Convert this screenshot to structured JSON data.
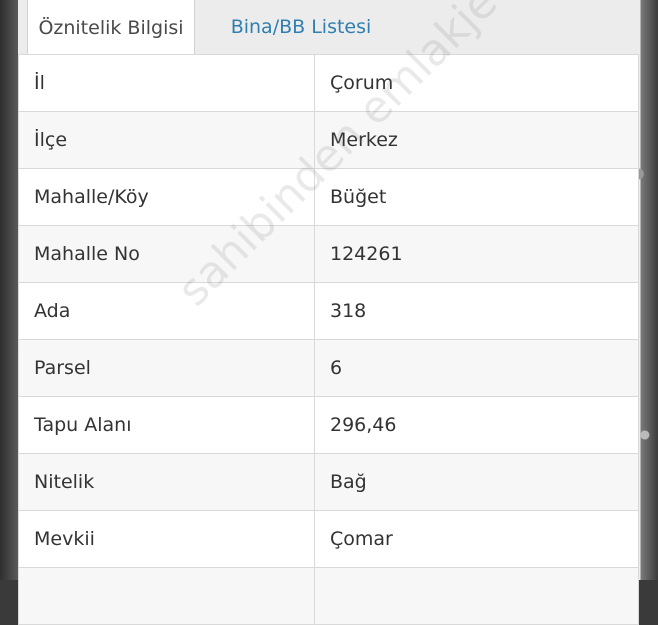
{
  "tabs": [
    {
      "label": "Öznitelik Bilgisi",
      "active": true
    },
    {
      "label": "Bina/BB Listesi",
      "active": false
    }
  ],
  "rows": [
    {
      "key": "İl",
      "value": "Çorum"
    },
    {
      "key": "İlçe",
      "value": "Merkez"
    },
    {
      "key": "Mahalle/Köy",
      "value": "Büğet"
    },
    {
      "key": "Mahalle No",
      "value": "124261"
    },
    {
      "key": "Ada",
      "value": "318"
    },
    {
      "key": "Parsel",
      "value": "6"
    },
    {
      "key": "Tapu Alanı",
      "value": "296,46"
    },
    {
      "key": "Nitelik",
      "value": "Bağ"
    },
    {
      "key": "Mevkii",
      "value": "Çomar"
    },
    {
      "key": "",
      "value": ""
    }
  ],
  "watermark": "sahibinden emlakjet.com",
  "colors": {
    "link": "#2f7fb0",
    "text": "#333333",
    "border": "#d9d9d9"
  }
}
